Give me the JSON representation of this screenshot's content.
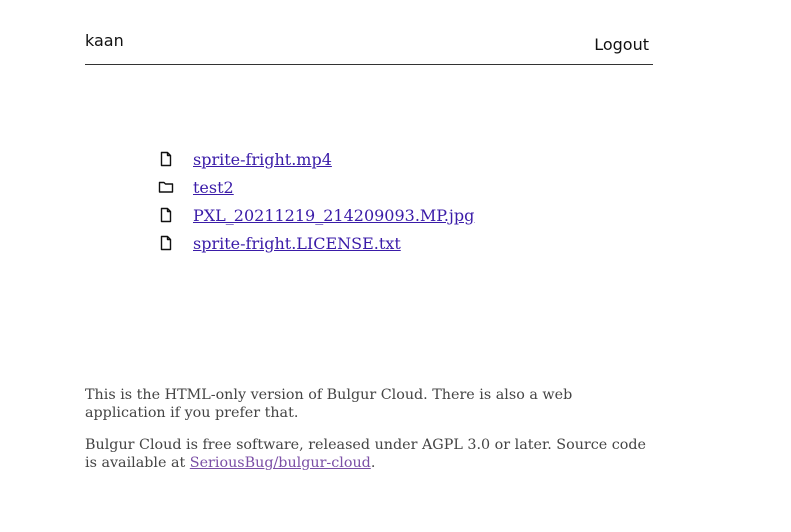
{
  "header": {
    "username": "kaan",
    "logout_label": "Logout"
  },
  "files": [
    {
      "name": "sprite-fright.mp4",
      "icon": "file-icon",
      "type": "file"
    },
    {
      "name": "test2",
      "icon": "folder-icon",
      "type": "folder"
    },
    {
      "name": "PXL_20211219_214209093.MP.jpg",
      "icon": "file-icon",
      "type": "file"
    },
    {
      "name": "sprite-fright.LICENSE.txt",
      "icon": "file-icon",
      "type": "file"
    }
  ],
  "footer": {
    "notice": "This is the HTML-only version of Bulgur Cloud. There is also a web application if you prefer that.",
    "license_text": "Bulgur Cloud is free software, released under AGPL 3.0 or later. Source code is available at ",
    "source_link": "SeriousBug/bulgur-cloud",
    "license_end": "."
  },
  "colors": {
    "link": "#3a1ba8",
    "visited_link": "#7b4fa6",
    "footer_text": "#444444",
    "divider": "#333333"
  }
}
